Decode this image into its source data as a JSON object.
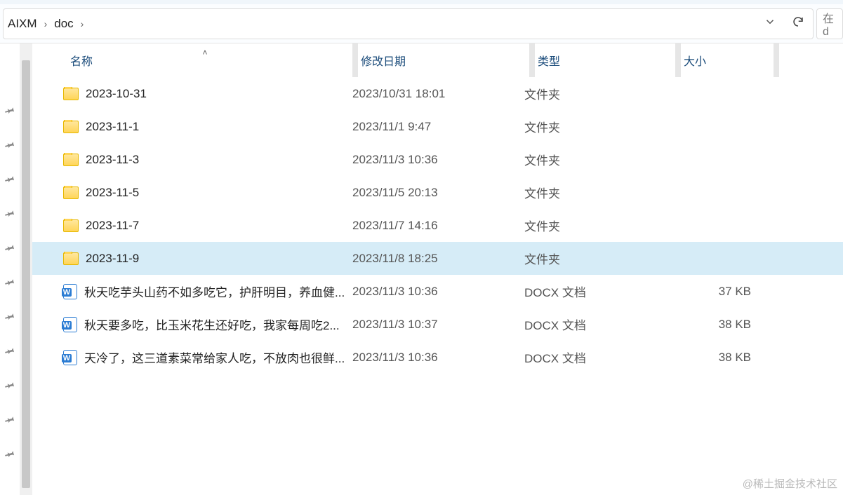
{
  "breadcrumb": {
    "segments": [
      "AIXM",
      "doc"
    ]
  },
  "search": {
    "placeholder": "在 d"
  },
  "columns": {
    "name": "名称",
    "date": "修改日期",
    "type": "类型",
    "size": "大小"
  },
  "files": [
    {
      "icon": "folder",
      "name": "2023-10-31",
      "date": "2023/10/31 18:01",
      "type": "文件夹",
      "size": "",
      "selected": false
    },
    {
      "icon": "folder",
      "name": "2023-11-1",
      "date": "2023/11/1 9:47",
      "type": "文件夹",
      "size": "",
      "selected": false
    },
    {
      "icon": "folder",
      "name": "2023-11-3",
      "date": "2023/11/3 10:36",
      "type": "文件夹",
      "size": "",
      "selected": false
    },
    {
      "icon": "folder",
      "name": "2023-11-5",
      "date": "2023/11/5 20:13",
      "type": "文件夹",
      "size": "",
      "selected": false
    },
    {
      "icon": "folder",
      "name": "2023-11-7",
      "date": "2023/11/7 14:16",
      "type": "文件夹",
      "size": "",
      "selected": false
    },
    {
      "icon": "folder",
      "name": "2023-11-9",
      "date": "2023/11/8 18:25",
      "type": "文件夹",
      "size": "",
      "selected": true
    },
    {
      "icon": "docx",
      "name": "秋天吃芋头山药不如多吃它，护肝明目，养血健...",
      "date": "2023/11/3 10:36",
      "type": "DOCX 文档",
      "size": "37 KB",
      "selected": false
    },
    {
      "icon": "docx",
      "name": "秋天要多吃，比玉米花生还好吃，我家每周吃2...",
      "date": "2023/11/3 10:37",
      "type": "DOCX 文档",
      "size": "38 KB",
      "selected": false
    },
    {
      "icon": "docx",
      "name": "天冷了，这三道素菜常给家人吃，不放肉也很鲜...",
      "date": "2023/11/3 10:36",
      "type": "DOCX 文档",
      "size": "38 KB",
      "selected": false
    }
  ],
  "pins_count": 11,
  "watermark": "@稀土掘金技术社区"
}
